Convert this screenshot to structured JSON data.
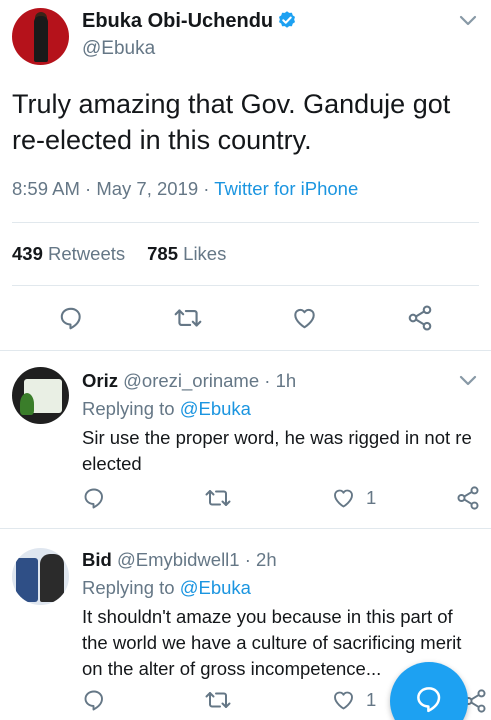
{
  "tweet": {
    "author_name": "Ebuka Obi-Uchendu",
    "author_handle": "@Ebuka",
    "text": "Truly amazing that Gov. Ganduje got re-elected in this country.",
    "time": "8:59 AM",
    "sep1": " · ",
    "date": "May 7, 2019",
    "sep2": " · ",
    "source": "Twitter for iPhone",
    "retweets_count": "439",
    "retweets_label": "Retweets",
    "likes_count": "785",
    "likes_label": "Likes"
  },
  "replies": [
    {
      "name": "Oriz",
      "handle": "@orezi_oriname",
      "age": "· 1h",
      "replying_prefix": "Replying to ",
      "replying_to": "@Ebuka",
      "text": "Sir use the proper word, he was rigged in not re elected",
      "like_count": "1"
    },
    {
      "name": "Bid",
      "handle": "@Emybidwell1",
      "age": "· 2h",
      "replying_prefix": "Replying to ",
      "replying_to": "@Ebuka",
      "text": "It shouldn't amaze you because in this part of the world we have a culture of sacrificing merit on the alter of gross incompetence...",
      "like_count": "1"
    }
  ],
  "colors": {
    "accent": "#1da1f2",
    "link": "#1b95e0",
    "secondary_text": "#657786",
    "icon_gray": "#657786"
  }
}
